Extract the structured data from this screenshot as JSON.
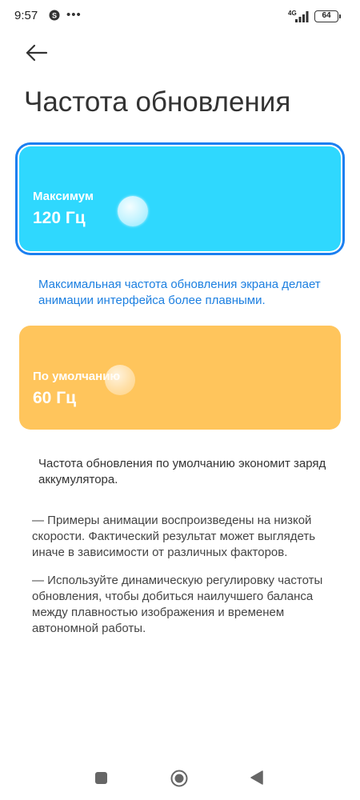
{
  "status_bar": {
    "time": "9:57",
    "network": "4G",
    "battery": "64",
    "icons": [
      "skype-icon",
      "more-dots-icon",
      "signal-icon",
      "battery-icon"
    ]
  },
  "header": {
    "back_icon": "arrow-left-icon",
    "title": "Частота обновления"
  },
  "options": [
    {
      "label": "Максимум",
      "value": "120 Гц",
      "selected": true,
      "color": "#2fd8fe",
      "border_color": "#1b7ff0",
      "description": "Максимальная частота обновления экрана делает анимации интерфейса более плавными."
    },
    {
      "label": "По умолчанию",
      "value": "60 Гц",
      "selected": false,
      "color": "#ffc55c",
      "description": "Частота обновления по умолчанию экономит заряд аккумулятора."
    }
  ],
  "notes": [
    "— Примеры анимации воспроизведены на низкой скорости. Фактический результат может выглядеть иначе в зависимости от различных факторов.",
    "— Используйте динамическую регулировку частоты обновления, чтобы добиться наилучшего баланса между плавностью изображения и временем автономной работы."
  ],
  "nav_bar": {
    "icons": [
      "square-recents-icon",
      "circle-home-icon",
      "triangle-back-icon"
    ]
  },
  "colors": {
    "accent_text": "#1c7fe0",
    "nav_icon": "#666666"
  }
}
